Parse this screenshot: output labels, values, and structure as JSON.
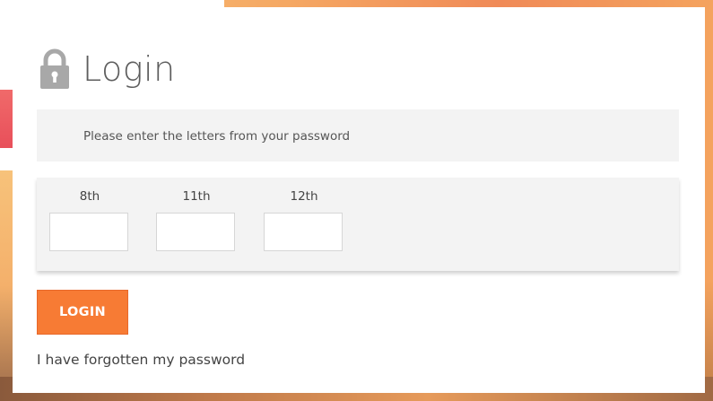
{
  "login": {
    "title": "Login",
    "instruction": "Please enter the letters from your password",
    "fields": [
      {
        "label": "8th",
        "value": ""
      },
      {
        "label": "11th",
        "value": ""
      },
      {
        "label": "12th",
        "value": ""
      }
    ],
    "login_button": "LOGIN",
    "forgot_link": "I have forgotten my password"
  },
  "colors": {
    "accent": "#f77b34",
    "panel_bg": "#f3f3f3",
    "title_text": "#5d5d5d",
    "lock_icon": "#a8a8a8"
  },
  "icons": {
    "title_icon": "lock-icon"
  }
}
